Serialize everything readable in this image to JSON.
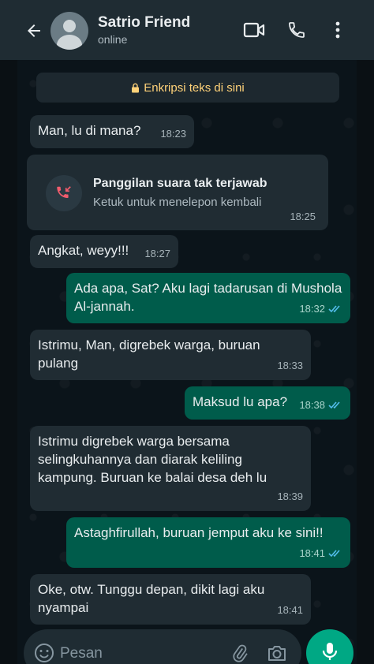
{
  "header": {
    "contact_name": "Satrio Friend",
    "status": "online",
    "icons": [
      "back-arrow-icon",
      "video-call-icon",
      "voice-call-icon",
      "more-options-icon"
    ]
  },
  "encryption_banner": {
    "text": "Enkripsi teks di sini"
  },
  "messages": [
    {
      "direction": "in",
      "text": "Man, lu di mana?",
      "time": "18:23"
    },
    {
      "direction": "in",
      "text": "Angkat, weyy!!!",
      "time": "18:27"
    },
    {
      "direction": "out",
      "text": "Ada apa, Sat? Aku lagi tadarusan di Mushola Al-jannah.",
      "time": "18:32",
      "read": true
    },
    {
      "direction": "in",
      "text": "Istrimu, Man, digrebek  warga, buruan pulang",
      "time": "18:33"
    },
    {
      "direction": "out",
      "text": "Maksud lu apa?",
      "time": "18:38",
      "read": true
    },
    {
      "direction": "in",
      "text": "Istrimu digrebek warga bersama selingkuhannya dan diarak keliling kampung. Buruan ke balai desa deh lu",
      "time": "18:39"
    },
    {
      "direction": "out",
      "text": "Astaghfirullah, buruan jemput aku ke sini!!",
      "time": "18:41",
      "read": true
    },
    {
      "direction": "in",
      "text": "Oke, otw. Tunggu depan, dikit lagi aku nyampai",
      "time": "18:41"
    }
  ],
  "missed_call": {
    "title": "Panggilan suara tak terjawab",
    "subtitle": "Ketuk untuk menelepon kembali",
    "time": "18:25"
  },
  "input_bar": {
    "placeholder": "Pesan"
  },
  "colors": {
    "header_bg": "#1f2c33",
    "chat_bg": "#0b141a",
    "incoming_bubble": "#202c33",
    "outgoing_bubble": "#005c4b",
    "accent": "#00a884",
    "read_ticks": "#53bdeb",
    "missed_call": "#f15c6d",
    "encryption_text": "#ffd279"
  }
}
